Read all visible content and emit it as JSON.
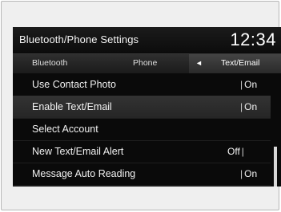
{
  "header": {
    "title": "Bluetooth/Phone Settings",
    "clock": "12:34"
  },
  "tabs": [
    {
      "label": "Bluetooth",
      "active": false
    },
    {
      "label": "Phone",
      "active": false
    },
    {
      "label": "Text/Email",
      "active": true
    }
  ],
  "active_tab_arrow": "◄",
  "settings": [
    {
      "label": "Use Contact Photo",
      "value_left": "",
      "value_right": "On",
      "highlighted": false
    },
    {
      "label": "Enable Text/Email",
      "value_left": "",
      "value_right": "On",
      "highlighted": true
    },
    {
      "label": "Select Account",
      "value_left": "",
      "value_right": "",
      "highlighted": false
    },
    {
      "label": "New Text/Email Alert",
      "value_left": "Off",
      "value_right": "",
      "highlighted": false
    },
    {
      "label": "Message Auto Reading",
      "value_left": "",
      "value_right": "On",
      "highlighted": false
    }
  ],
  "separator": "|",
  "colors": {
    "screen_bg": "#0a0a0a",
    "highlight_row": "#2e2e2e",
    "text": "#f2f2f2"
  }
}
